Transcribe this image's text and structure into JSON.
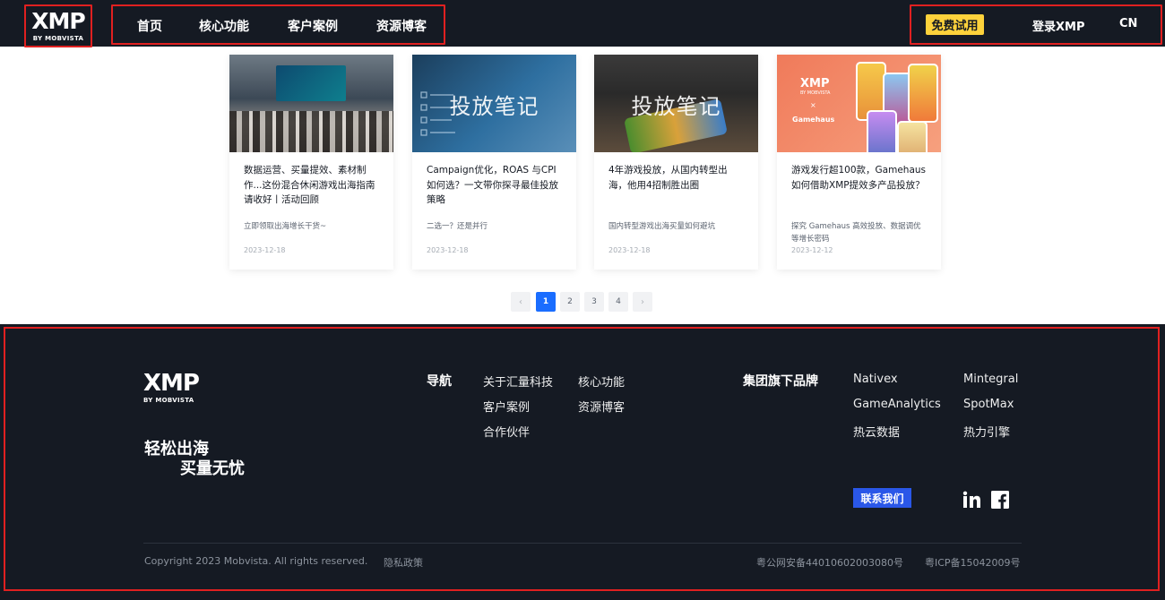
{
  "header": {
    "logo": {
      "mark": "XMP",
      "sub": "BY MOBVISTA"
    },
    "nav": [
      {
        "label": "首页"
      },
      {
        "label": "核心功能"
      },
      {
        "label": "客户案例"
      },
      {
        "label": "资源博客"
      }
    ],
    "trial_label": "免费试用",
    "login_label": "登录XMP",
    "lang_label": "CN"
  },
  "articles": [
    {
      "thumb_text": "",
      "title": "数据运营、买量提效、素材制作...这份混合休闲游戏出海指南请收好丨活动回顾",
      "desc": "立即领取出海增长干货~",
      "date": "2023-12-18"
    },
    {
      "thumb_text": "投放笔记",
      "title": "Campaign优化，ROAS 与CPI 如何选？一文带你探寻最佳投放策略",
      "desc": "二选一？还是并行",
      "date": "2023-12-18"
    },
    {
      "thumb_text": "投放笔记",
      "title": "4年游戏投放，从国内转型出海，他用4招制胜出圈",
      "desc": "国内转型游戏出海买量如何避坑",
      "date": "2023-12-18"
    },
    {
      "thumb_text": "",
      "title": "游戏发行超100款，Gamehaus 如何借助XMP提效多产品投放？",
      "desc": "探究 Gamehaus 高效投放、数据调优等增长密码",
      "date": "2023-12-12"
    }
  ],
  "thumb4": {
    "logo": "XMP",
    "sub": "BY MOBVISTA",
    "x": "×",
    "brand": "Gamehaus"
  },
  "pagination": {
    "prev": "‹",
    "pages": [
      "1",
      "2",
      "3",
      "4"
    ],
    "active": "1",
    "next": "›"
  },
  "footer": {
    "logo": {
      "mark": "XMP",
      "sub": "BY MOBVISTA"
    },
    "slogan_line1": "轻松出海",
    "slogan_line2": "买量无忧",
    "nav_heading": "导航",
    "nav_links": [
      "关于汇量科技",
      "核心功能",
      "客户案例",
      "资源博客",
      "合作伙伴"
    ],
    "brands_heading": "集团旗下品牌",
    "brands": [
      "Nativex",
      "Mintegral",
      "GameAnalytics",
      "SpotMax",
      "热云数据",
      "热力引擎"
    ],
    "contact_label": "联系我们",
    "copyright": "Copyright 2023 Mobvista. All rights reserved.",
    "privacy_label": "隐私政策",
    "police_record": "粤公网安备44010602003080号",
    "icp_record": "粤ICP备15042009号"
  },
  "icons": {
    "linkedin": "linkedin-icon",
    "facebook": "facebook-icon"
  },
  "colors": {
    "accent_yellow": "#fdd23b",
    "page_blue": "#1a6dff",
    "contact_blue": "#2a57e8",
    "dark_bg": "#151a23",
    "highlight_red": "#e02020"
  }
}
